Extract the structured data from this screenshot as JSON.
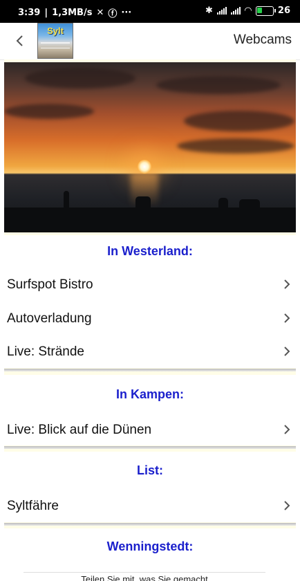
{
  "status_bar": {
    "time": "3:39",
    "network_speed": "1,3MB/s",
    "battery": "26"
  },
  "header": {
    "logo_text": "Sylt",
    "title": "Webcams"
  },
  "sections": [
    {
      "heading": "In Westerland:",
      "items": [
        {
          "label": "Surfspot Bistro"
        },
        {
          "label": "Autoverladung"
        },
        {
          "label": "Live: Strände"
        }
      ]
    },
    {
      "heading": "In Kampen:",
      "items": [
        {
          "label": "Live: Blick auf die Dünen"
        }
      ]
    },
    {
      "heading": "List:",
      "items": [
        {
          "label": "Syltfähre"
        }
      ]
    },
    {
      "heading": "Wenningstedt:",
      "items": []
    }
  ],
  "footer": {
    "share_text": "Teilen Sie mit, was Sie gemacht"
  }
}
